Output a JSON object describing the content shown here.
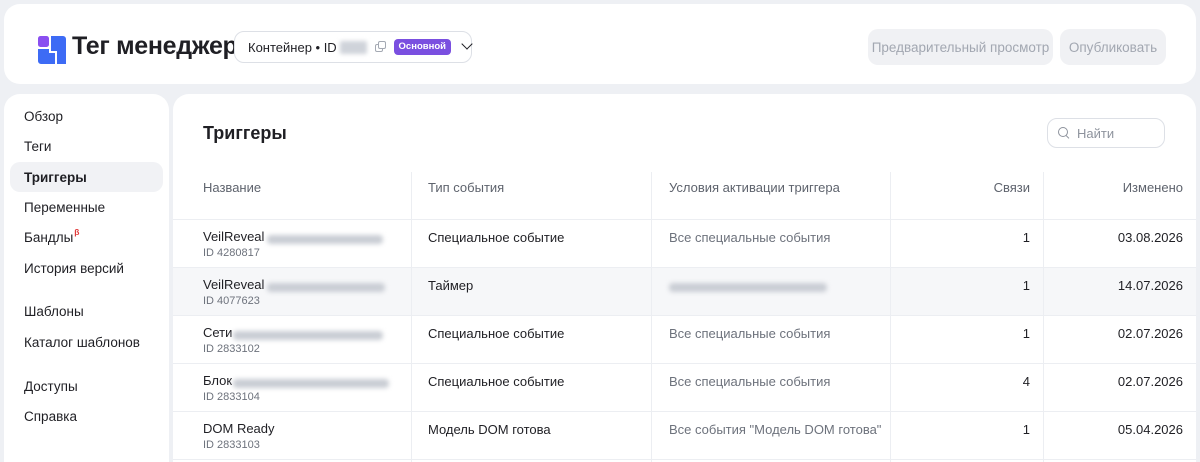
{
  "header": {
    "logo_text": "Тег менеджер",
    "container_label": "Контейнер • ID",
    "badge": "Основной",
    "preview_button": "Предварительный просмотр",
    "publish_button": "Опубликовать"
  },
  "sidebar": {
    "items": [
      {
        "label": "Обзор"
      },
      {
        "label": "Теги"
      },
      {
        "label": "Триггеры",
        "active": true
      },
      {
        "label": "Переменные"
      },
      {
        "label": "Бандлы",
        "superscript": "β"
      },
      {
        "label": "История версий"
      },
      {
        "label": "Шаблоны"
      },
      {
        "label": "Каталог шаблонов"
      },
      {
        "label": "Доступы"
      },
      {
        "label": "Справка"
      }
    ]
  },
  "main": {
    "title": "Триггеры",
    "search_placeholder": "Найти",
    "columns": [
      "Название",
      "Тип события",
      "Условия активации триггера",
      "Связи",
      "Изменено"
    ],
    "rows": [
      {
        "name": "VeilReveal",
        "id": "ID 4280817",
        "event": "Специальное событие",
        "conditions": "Все специальные события",
        "links": "1",
        "modified": "03.08.2026"
      },
      {
        "name": "VeilReveal",
        "id": "ID 4077623",
        "event": "Таймер",
        "conditions": "",
        "links": "1",
        "modified": "14.07.2026"
      },
      {
        "name": "Сети",
        "id": "ID 2833102",
        "event": "Специальное событие",
        "conditions": "Все специальные события",
        "links": "1",
        "modified": "02.07.2026"
      },
      {
        "name": "Блок",
        "id": "ID 2833104",
        "event": "Специальное событие",
        "conditions": "Все специальные события",
        "links": "4",
        "modified": "02.07.2026"
      },
      {
        "name": "DOM Ready",
        "id": "ID 2833103",
        "event": "Модель DOM готова",
        "conditions": "Все события \"Модель DOM готова\"",
        "links": "1",
        "modified": "05.04.2026"
      }
    ]
  },
  "colors": {
    "accent": "#7a4fe0",
    "logo_blue": "#3d6bf5",
    "logo_purple": "#8a4ff0"
  }
}
